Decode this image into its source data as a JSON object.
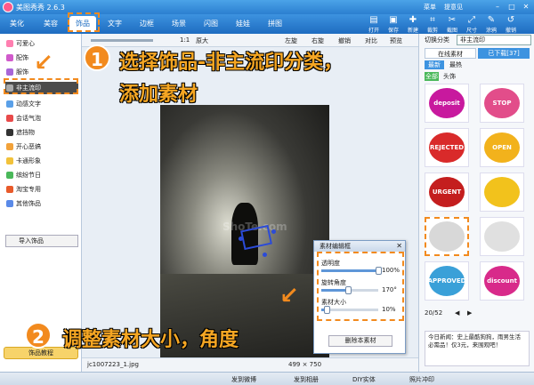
{
  "app": {
    "title": "美图秀秀 2.6.3",
    "menu_label": "菜单",
    "feedback_label": "提意见"
  },
  "tabs": [
    {
      "label": "美化"
    },
    {
      "label": "美容"
    },
    {
      "label": "饰品"
    },
    {
      "label": "文字"
    },
    {
      "label": "边框"
    },
    {
      "label": "场景"
    },
    {
      "label": "闪图"
    },
    {
      "label": "娃娃"
    },
    {
      "label": "拼图"
    }
  ],
  "tools": [
    {
      "label": "打开"
    },
    {
      "label": "保存"
    },
    {
      "label": "新建"
    },
    {
      "label": "裁剪"
    },
    {
      "label": "截图"
    },
    {
      "label": "尺寸"
    },
    {
      "label": "涂鸦"
    },
    {
      "label": "撤销"
    }
  ],
  "categories": [
    {
      "label": "可爱心",
      "color": "#ff7fb0"
    },
    {
      "label": "配饰",
      "color": "#d05acb"
    },
    {
      "label": "服饰",
      "color": "#a866d8"
    },
    {
      "label": "非主流印",
      "color": "#888888"
    },
    {
      "label": "动感文字",
      "color": "#5aa0e8"
    },
    {
      "label": "会话气泡",
      "color": "#e84a4a"
    },
    {
      "label": "遮挡物",
      "color": "#333333"
    },
    {
      "label": "开心恶搞",
      "color": "#f2a23a"
    },
    {
      "label": "卡通形象",
      "color": "#f2c23a"
    },
    {
      "label": "缤纷节日",
      "color": "#4ab85a"
    },
    {
      "label": "淘宝专用",
      "color": "#e85a2a"
    },
    {
      "label": "其他饰品",
      "color": "#5a8ae8"
    }
  ],
  "import_label": "导入饰品",
  "tutorial_label": "饰品教程",
  "canvas": {
    "zoom": "1:1",
    "zoom_label": "原大",
    "rotate_left": "左旋",
    "rotate_right": "右旋",
    "compare": "对比",
    "preview": "预览",
    "undo": "撤销",
    "redo": "重做",
    "filename": "jc1007223_1.jpg",
    "dimensions": "499 × 750",
    "watermark": "ShoTe.com"
  },
  "dialog": {
    "title": "素材编辑框",
    "opacity_label": "透明度",
    "opacity_value": "100%",
    "opacity_pct": 100,
    "rotation_label": "旋转角度",
    "rotation_value": "170°",
    "rotation_pct": 47,
    "size_label": "素材大小",
    "size_value": "10%",
    "size_pct": 10,
    "delete_label": "删除本素材"
  },
  "right_panel": {
    "category_label": "切换分类",
    "category_value": "非主流印",
    "tab_online": "在线素材",
    "tab_downloaded": "已下载[37]",
    "sub_latest": "最新",
    "sub_hot": "最热",
    "filter_all": "全部",
    "filter_head": "头饰",
    "thumbs": [
      {
        "text": "deposit",
        "color": "#c8199e"
      },
      {
        "text": "STOP",
        "color": "#e24d8a"
      },
      {
        "text": "REJECTED",
        "color": "#d92a2a"
      },
      {
        "text": "OPEN",
        "color": "#f2b21c"
      },
      {
        "text": "URGENT",
        "color": "#c41e1e"
      },
      {
        "text": "",
        "color": "#f2c21c"
      },
      {
        "text": "",
        "color": "#d8d8d8"
      },
      {
        "text": "",
        "color": "#e0e0e0"
      },
      {
        "text": "APPROVED",
        "color": "#3aa0d8"
      },
      {
        "text": "discount",
        "color": "#d82a8a"
      }
    ],
    "page": "20/52",
    "news": "今日新闻：史上最酷狗狗，雨男生活必需品！仅3元，来围观吧！"
  },
  "bottom": {
    "weibo": "发到微博",
    "qzone": "发到相册",
    "diy": "DIY实体",
    "photo": "照片冲印"
  },
  "annotations": {
    "step1_num": "1",
    "step1_line1": "选择饰品-非主流印分类，",
    "step1_line2": "添加素材",
    "step2_num": "2",
    "step2_text": "调整素材大小，角度"
  }
}
